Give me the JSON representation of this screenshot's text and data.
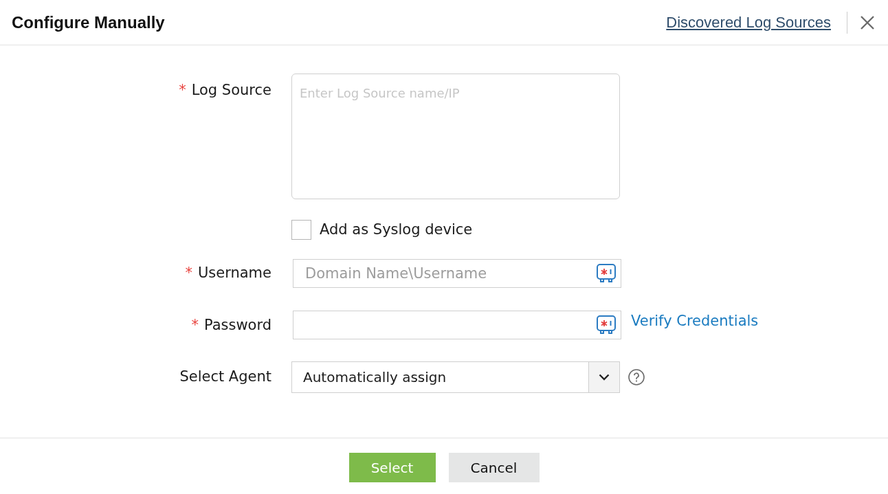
{
  "dialog": {
    "title": "Configure Manually",
    "header_link": "Discovered Log Sources"
  },
  "fields": [
    {
      "kind": "textarea",
      "required_mark": "*",
      "label": "Log Source",
      "placeholder": "Enter Log Source name/IP"
    },
    {
      "kind": "checkbox",
      "label": "Add as Syslog device",
      "checked": false
    },
    {
      "kind": "text",
      "required_mark": "*",
      "label": "Username",
      "placeholder": "Domain Name\\Username"
    },
    {
      "kind": "password",
      "required_mark": "*",
      "label": "Password",
      "link": "Verify Credentials"
    },
    {
      "kind": "select",
      "label": "Select Agent",
      "value": "Automatically assign"
    }
  ],
  "buttons": [
    {
      "kind": "primary",
      "label": "Select"
    },
    {
      "kind": "secondary",
      "label": "Cancel"
    }
  ]
}
